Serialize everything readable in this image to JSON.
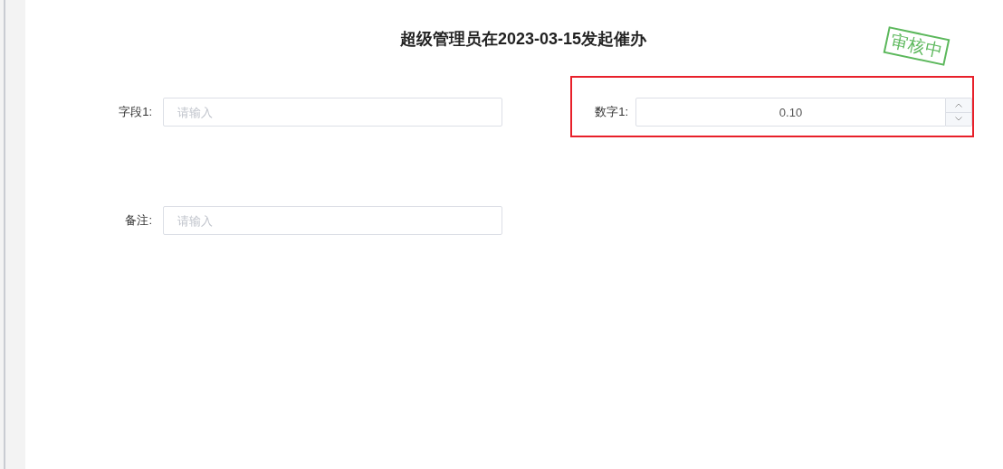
{
  "title": "超级管理员在2023-03-15发起催办",
  "stamp": {
    "text": "审核中"
  },
  "rows": [
    {
      "fields": [
        {
          "kind": "text",
          "label": "字段1:",
          "placeholder": "请输入",
          "highlighted": false
        },
        {
          "kind": "number",
          "label": "数字1:",
          "value": "0.10",
          "highlighted": true
        }
      ]
    },
    {
      "fields": [
        {
          "kind": "text",
          "label": "备注:",
          "placeholder": "请输入",
          "highlighted": false
        }
      ]
    }
  ]
}
